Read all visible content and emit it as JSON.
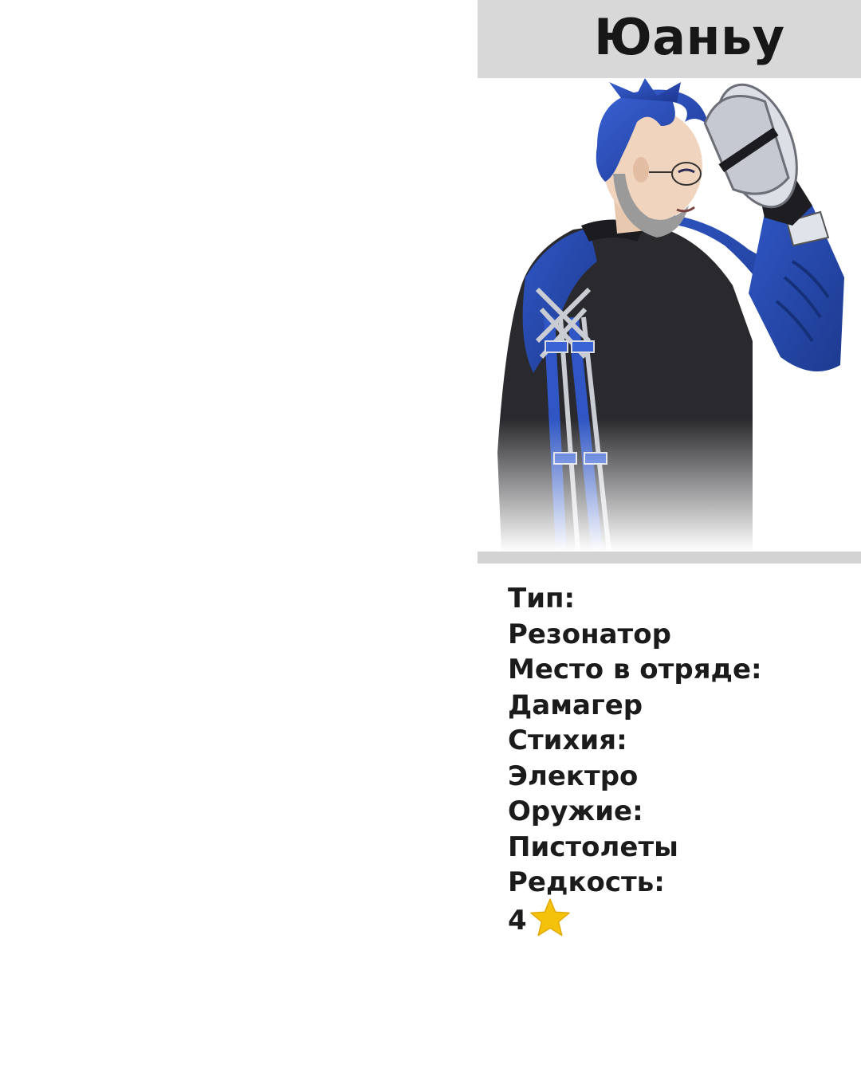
{
  "card": {
    "title": "Юаньу",
    "portrait_icon": "character-portrait",
    "info": [
      {
        "label": "Тип:",
        "value": "Резонатор"
      },
      {
        "label": "Место в отряде:",
        "value": "Дамагер"
      },
      {
        "label": "Стихия:",
        "value": "Электро"
      },
      {
        "label": "Оружие:",
        "value": "Пистолеты"
      },
      {
        "label": "Редкость:"
      }
    ],
    "rarity": {
      "value": "4",
      "icon": "star-icon",
      "color": "#f5c20b"
    }
  },
  "colors": {
    "title_bar": "#d8d8d8",
    "divider": "#d3d3d3",
    "text": "#1b1b1b",
    "accent_blue": "#2a4fb8"
  }
}
